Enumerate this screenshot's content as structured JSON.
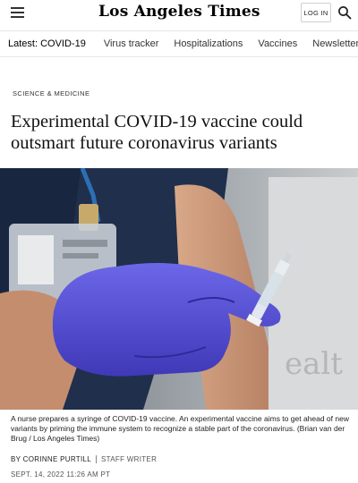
{
  "header": {
    "masthead": "Los Angeles Times",
    "login_label": "LOG IN"
  },
  "nav": {
    "latest_label": "Latest: COVID-19",
    "items": [
      {
        "label": "Virus tracker"
      },
      {
        "label": "Hospitalizations"
      },
      {
        "label": "Vaccines"
      },
      {
        "label": "Newsletter"
      }
    ]
  },
  "article": {
    "kicker": "SCIENCE & MEDICINE",
    "headline": "Experimental COVID-19 vaccine could outsmart future coronavirus variants",
    "caption": "A nurse prepares a syringe of COVID-19 vaccine. An experimental vaccine aims to get ahead of new variants by priming the immune system to recognize a stable part of the coronavirus. (Brian van der Brug / Los Angeles Times)",
    "byline": "BY CORINNE PURTILL",
    "role": "STAFF WRITER",
    "dateline": "SEPT. 14, 2022 11:26 AM PT"
  },
  "colors": {
    "glove": "#5b57d6",
    "scrubs": "#1f2f4c",
    "background": "#ffffff"
  }
}
